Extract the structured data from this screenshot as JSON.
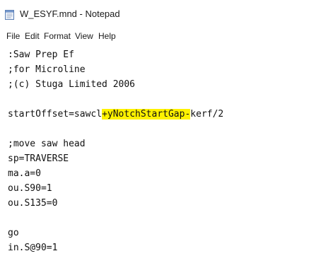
{
  "window": {
    "title": "W_ESYF.mnd - Notepad"
  },
  "icons": {
    "app": "notepad-icon"
  },
  "menu": {
    "items": [
      "File",
      "Edit",
      "Format",
      "View",
      "Help"
    ]
  },
  "editor": {
    "lines": [
      ":Saw Prep Ef",
      ";for Microline",
      ";(c) Stuga Limited 2006",
      "",
      "startOffset=sawcl+yNotchStartGap-kerf/2",
      "",
      ";move saw head",
      "sp=TRAVERSE",
      "ma.a=0",
      "ou.S90=1",
      "ou.S135=0",
      "",
      "go",
      "in.S@90=1"
    ],
    "highlight": {
      "line": "startOffset=sawcl+yNotchStartGap-kerf/2",
      "before": "startOffset=sawcl",
      "marked": "+yNotchStartGap-",
      "after": "kerf/2",
      "color": "#fff200"
    }
  }
}
